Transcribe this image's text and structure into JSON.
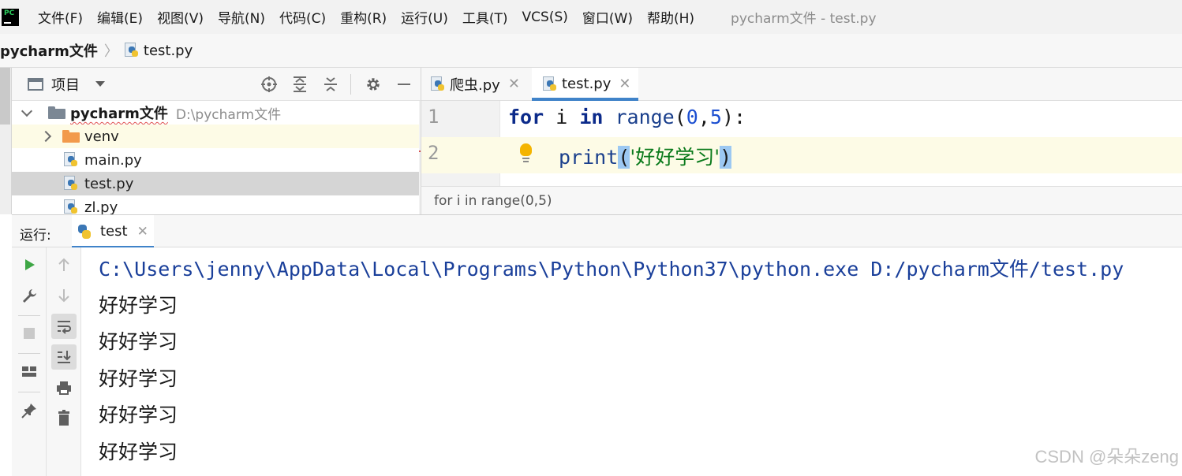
{
  "menubar": {
    "items": [
      "文件(F)",
      "编辑(E)",
      "视图(V)",
      "导航(N)",
      "代码(C)",
      "重构(R)",
      "运行(U)",
      "工具(T)",
      "VCS(S)",
      "窗口(W)",
      "帮助(H)"
    ],
    "window_title": "pycharm文件 - test.py"
  },
  "breadcrumb": {
    "project": "pycharm文件",
    "file": "test.py"
  },
  "project_panel": {
    "title": "项目",
    "tree": {
      "root_name": "pycharm文件",
      "root_path": "D:\\pycharm文件",
      "items": [
        "venv",
        "main.py",
        "test.py",
        "zl.py"
      ]
    }
  },
  "editor": {
    "tabs": [
      {
        "label": "爬虫.py",
        "active": false
      },
      {
        "label": "test.py",
        "active": true
      }
    ],
    "lines": [
      {
        "num": "1",
        "kw1": "for",
        "var": " i ",
        "kw2": "in",
        "fn": " range",
        "open": "(",
        "n1": "0",
        "comma": ",",
        "n2": "5",
        "close": "):"
      },
      {
        "num": "2",
        "fn": "print",
        "open": "(",
        "str": "'好好学习'",
        "close": ")"
      }
    ],
    "status_text": "for i in range(0,5)"
  },
  "run_panel": {
    "label": "运行:",
    "tab_label": "test",
    "console": {
      "command": "C:\\Users\\jenny\\AppData\\Local\\Programs\\Python\\Python37\\python.exe D:/pycharm文件/test.py",
      "outputs": [
        "好好学习",
        "好好学习",
        "好好学习",
        "好好学习",
        "好好学习"
      ]
    }
  },
  "watermark": "CSDN @朵朵zeng",
  "colors": {
    "accent": "#4083c9",
    "keyword": "#0b2a8a",
    "string": "#0a7a1b",
    "number": "#1c4fd1",
    "current_line": "#fdfbe6"
  },
  "icons": {
    "run": "play-icon",
    "settings": "wrench-icon",
    "stop": "stop-icon",
    "layout": "layout-icon",
    "pin": "pin-icon",
    "up": "arrow-up-icon",
    "down": "arrow-down-icon",
    "wrap": "soft-wrap-icon",
    "scroll_end": "scroll-to-end-icon",
    "print": "print-icon",
    "clear": "trash-icon"
  }
}
